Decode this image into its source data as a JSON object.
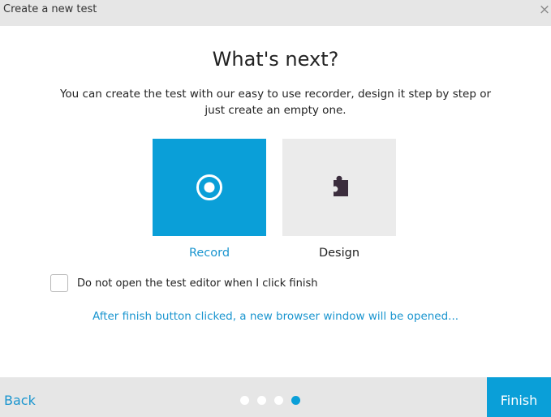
{
  "window": {
    "title": "Create a new test",
    "close_glyph": "×",
    "close_icon": "close-icon"
  },
  "main": {
    "heading": "What's next?",
    "description": "You can create the test with our easy to use recorder, design it step by step or just create an empty one."
  },
  "options": [
    {
      "label": "Record",
      "icon": "record-icon",
      "selected": true
    },
    {
      "label": "Design",
      "icon": "puzzle-piece-icon",
      "selected": false
    }
  ],
  "checkbox": {
    "label": "Do not open the test editor when I click finish",
    "checked": false
  },
  "info_text": "After finish button clicked, a new browser window will be opened...",
  "footer": {
    "back_label": "Back",
    "finish_label": "Finish",
    "steps_total": 4,
    "current_step": 4
  },
  "colors": {
    "accent": "#0a9fd8",
    "link": "#1a95cf",
    "bar_background": "#e6e6e6",
    "tile_inactive": "#ebebeb",
    "puzzle_icon": "#3b2d3d"
  }
}
